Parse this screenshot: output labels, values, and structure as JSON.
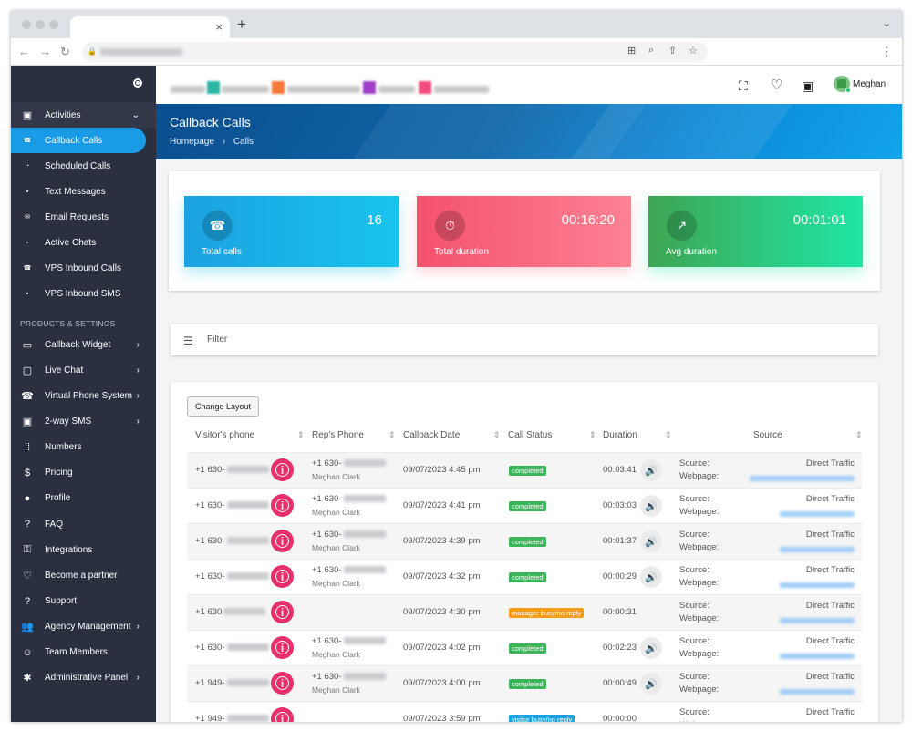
{
  "browser": {
    "tab_close": "×",
    "new_tab": "+",
    "tab_menu": "⌄",
    "nav_back": "←",
    "nav_forward": "→",
    "nav_reload": "↻",
    "lock": "🔒",
    "kebab": "⋮"
  },
  "sidebar": {
    "toggle_icon": "radio-target-icon",
    "items": [
      {
        "label": "Activities",
        "icon": "▣",
        "chevron": "⌄"
      },
      {
        "label": "Callback Calls",
        "icon": "☎"
      },
      {
        "label": "Scheduled Calls",
        "icon": "◔"
      },
      {
        "label": "Text Messages",
        "icon": "▪"
      },
      {
        "label": "Email Requests",
        "icon": "✉"
      },
      {
        "label": "Active Chats",
        "icon": "▫"
      },
      {
        "label": "VPS Inbound Calls",
        "icon": "☎"
      },
      {
        "label": "VPS Inbound SMS",
        "icon": "▪"
      }
    ],
    "section_title": "PRODUCTS & SETTINGS",
    "settings": [
      {
        "label": "Callback Widget",
        "icon": "▭",
        "chevron": "›"
      },
      {
        "label": "Live Chat",
        "icon": "▢",
        "chevron": "›"
      },
      {
        "label": "Virtual Phone System",
        "icon": "☎",
        "chevron": "›"
      },
      {
        "label": "2-way SMS",
        "icon": "▣",
        "chevron": "›"
      },
      {
        "label": "Numbers",
        "icon": "⁞⁞"
      },
      {
        "label": "Pricing",
        "icon": "$"
      },
      {
        "label": "Profile",
        "icon": "●"
      },
      {
        "label": "FAQ",
        "icon": "?"
      },
      {
        "label": "Integrations",
        "icon": "⚿"
      },
      {
        "label": "Become a partner",
        "icon": "♡"
      },
      {
        "label": "Support",
        "icon": "?"
      },
      {
        "label": "Agency Management",
        "icon": "👥",
        "chevron": "›"
      },
      {
        "label": "Team Members",
        "icon": "☺"
      },
      {
        "label": "Administrative Panel",
        "icon": "✱",
        "chevron": "›"
      }
    ]
  },
  "header": {
    "fullscreen_icon": "⛶",
    "heart_icon": "♡",
    "wallet_icon": "▣",
    "user_name": "Meghan"
  },
  "banner": {
    "title": "Callback Calls",
    "breadcrumb_home": "Homepage",
    "breadcrumb_sep": "›",
    "breadcrumb_current": "Calls"
  },
  "stats": [
    {
      "label": "Total calls",
      "value": "16",
      "icon": "☎",
      "color_from": "#1ca1e1",
      "color_to": "#18c4ec"
    },
    {
      "label": "Total duration",
      "value": "00:16:20",
      "icon": "⏱",
      "color_from": "#f4516c",
      "color_to": "#fd8293"
    },
    {
      "label": "Avg duration",
      "value": "00:01:01",
      "icon": "↗",
      "color_from": "#3ea552",
      "color_to": "#1fe6a4"
    }
  ],
  "filter": {
    "label": "Filter",
    "icon": "☰"
  },
  "table": {
    "change_layout": "Change Layout",
    "columns": [
      "Visitor's phone",
      "Rep's Phone",
      "Callback Date",
      "Call Status",
      "Duration",
      "Source"
    ],
    "sort_icon": "⇕",
    "source_label": "Source:",
    "webpage_label": "Webpage:",
    "info_icon": "i",
    "speaker_icon": "🔊",
    "rows": [
      {
        "visitor": "+1 630-",
        "rep_phone": "+1 630-",
        "rep_name": "Meghan Clark",
        "date": "09/07/2023 4:45 pm",
        "status": "completed",
        "status_color": "#3cb55a",
        "duration": "00:03:41",
        "source": "Direct Traffic"
      },
      {
        "visitor": "+1 630-",
        "rep_phone": "+1 630-",
        "rep_name": "Meghan Clark",
        "date": "09/07/2023 4:41 pm",
        "status": "completed",
        "status_color": "#3cb55a",
        "duration": "00:03:03",
        "source": "Direct Traffic"
      },
      {
        "visitor": "+1 630-",
        "rep_phone": "+1 630-",
        "rep_name": "Meghan Clark",
        "date": "09/07/2023 4:39 pm",
        "status": "completed",
        "status_color": "#3cb55a",
        "duration": "00:01:37",
        "source": "Direct Traffic"
      },
      {
        "visitor": "+1 630-",
        "rep_phone": "+1 630-",
        "rep_name": "Meghan Clark",
        "date": "09/07/2023 4:32 pm",
        "status": "completed",
        "status_color": "#3cb55a",
        "duration": "00:00:29",
        "source": "Direct Traffic"
      },
      {
        "visitor": "+1 630",
        "rep_phone": "",
        "rep_name": "",
        "date": "09/07/2023 4:30 pm",
        "status": "manager busy/no reply",
        "status_color": "#f59c1a",
        "duration": "00:00:31",
        "source": "Direct Traffic"
      },
      {
        "visitor": "+1 630-",
        "rep_phone": "+1 630-",
        "rep_name": "Meghan Clark",
        "date": "09/07/2023 4:02 pm",
        "status": "completed",
        "status_color": "#3cb55a",
        "duration": "00:02:23",
        "source": "Direct Traffic"
      },
      {
        "visitor": "+1 949-",
        "rep_phone": "+1 630-",
        "rep_name": "Meghan Clark",
        "date": "09/07/2023 4:00 pm",
        "status": "completed",
        "status_color": "#3cb55a",
        "duration": "00:00:49",
        "source": "Direct Traffic"
      },
      {
        "visitor": "+1 949-",
        "rep_phone": "",
        "rep_name": "",
        "date": "09/07/2023 3:59 pm",
        "status": "visitor busy/no reply",
        "status_color": "#1ba3e4",
        "duration": "00:00:00",
        "source": "Direct Traffic"
      }
    ]
  }
}
